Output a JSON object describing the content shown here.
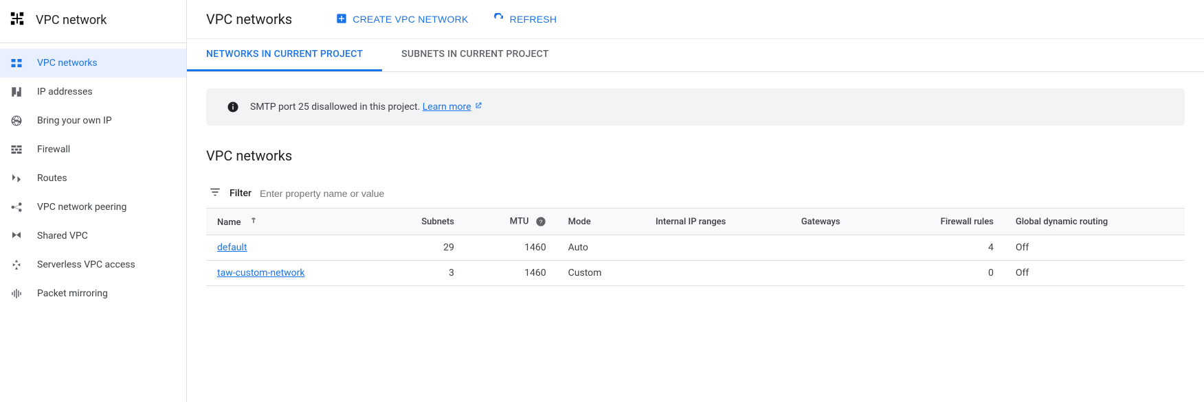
{
  "sidebar": {
    "title": "VPC network",
    "items": [
      {
        "label": "VPC networks"
      },
      {
        "label": "IP addresses"
      },
      {
        "label": "Bring your own IP"
      },
      {
        "label": "Firewall"
      },
      {
        "label": "Routes"
      },
      {
        "label": "VPC network peering"
      },
      {
        "label": "Shared VPC"
      },
      {
        "label": "Serverless VPC access"
      },
      {
        "label": "Packet mirroring"
      }
    ]
  },
  "header": {
    "title": "VPC networks",
    "create_label": "CREATE VPC NETWORK",
    "refresh_label": "REFRESH"
  },
  "tabs": [
    {
      "label": "NETWORKS IN CURRENT PROJECT"
    },
    {
      "label": "SUBNETS IN CURRENT PROJECT"
    }
  ],
  "banner": {
    "text": "SMTP port 25 disallowed in this project. ",
    "link_label": "Learn more"
  },
  "section_title": "VPC networks",
  "filter": {
    "label": "Filter",
    "placeholder": "Enter property name or value"
  },
  "table": {
    "columns": [
      "Name",
      "Subnets",
      "MTU",
      "Mode",
      "Internal IP ranges",
      "Gateways",
      "Firewall rules",
      "Global dynamic routing"
    ],
    "rows": [
      {
        "name": "default",
        "subnets": "29",
        "mtu": "1460",
        "mode": "Auto",
        "internal": "",
        "gateways": "",
        "firewall": "4",
        "gdr": "Off"
      },
      {
        "name": "taw-custom-network",
        "subnets": "3",
        "mtu": "1460",
        "mode": "Custom",
        "internal": "",
        "gateways": "",
        "firewall": "0",
        "gdr": "Off"
      }
    ]
  }
}
